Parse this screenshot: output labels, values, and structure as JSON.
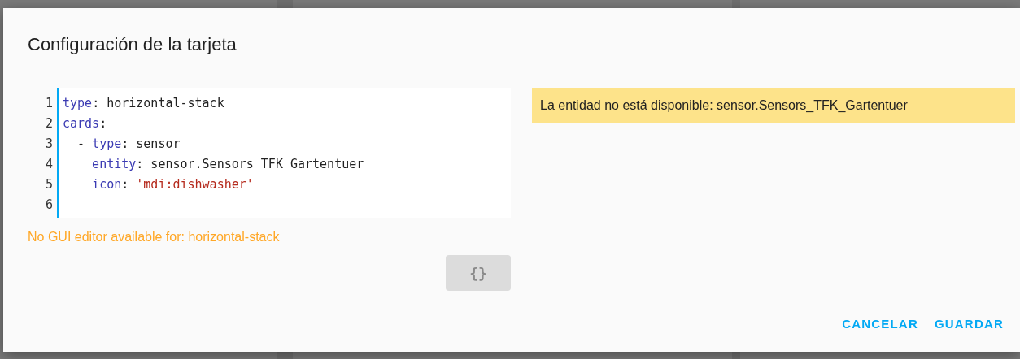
{
  "dialog": {
    "title": "Configuración de la tarjeta",
    "editor": {
      "lines": [
        {
          "number": "1",
          "tokens": [
            {
              "kind": "key",
              "text": "type"
            },
            {
              "kind": "plain",
              "text": ": horizontal-stack"
            }
          ]
        },
        {
          "number": "2",
          "tokens": [
            {
              "kind": "key",
              "text": "cards"
            },
            {
              "kind": "plain",
              "text": ":"
            }
          ]
        },
        {
          "number": "3",
          "tokens": [
            {
              "kind": "plain",
              "text": "  - "
            },
            {
              "kind": "key",
              "text": "type"
            },
            {
              "kind": "plain",
              "text": ": sensor"
            }
          ]
        },
        {
          "number": "4",
          "tokens": [
            {
              "kind": "key",
              "text": "    entity"
            },
            {
              "kind": "plain",
              "text": ": sensor.Sensors_TFK_Gartentuer"
            }
          ]
        },
        {
          "number": "5",
          "tokens": [
            {
              "kind": "key",
              "text": "    icon"
            },
            {
              "kind": "plain",
              "text": ": "
            },
            {
              "kind": "string",
              "text": "'mdi:dishwasher'"
            }
          ]
        },
        {
          "number": "6"
        }
      ]
    },
    "editor_warning": "No GUI editor available for: horizontal-stack",
    "toggle_button": {
      "label": "{}",
      "disabled": true
    },
    "preview_warning": "La entidad no está disponible: sensor.Sensors_TFK_Gartentuer",
    "buttons": [
      {
        "label": "CANCELAR"
      },
      {
        "label": "GUARDAR"
      }
    ]
  }
}
